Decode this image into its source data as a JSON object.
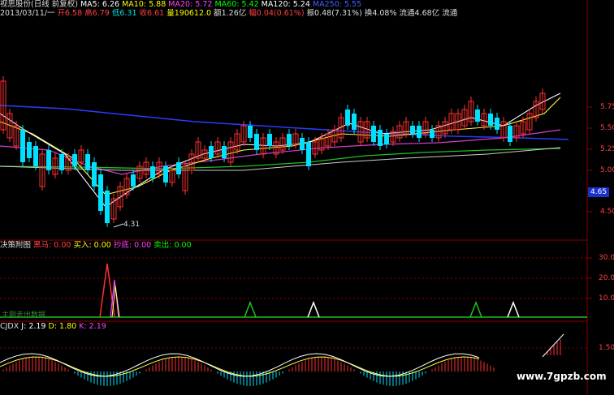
{
  "header": {
    "title": "视思股份(日线 前复权)",
    "ma": [
      {
        "label": "MA5: 6.26",
        "color": "#ffffff"
      },
      {
        "label": "MA10: 5.88",
        "color": "#ffff00"
      },
      {
        "label": "MA20: 5.72",
        "color": "#ff40ff"
      },
      {
        "label": "MA60: 5.42",
        "color": "#00ff00"
      },
      {
        "label": "MA120: 5.24",
        "color": "#ffffff"
      },
      {
        "label": "MA250: 5.55",
        "color": "#4060ff"
      }
    ],
    "info_line": [
      {
        "t": "2013/03/11/一",
        "c": "#dddddd"
      },
      {
        "t": "开6.58",
        "c": "#ff4040"
      },
      {
        "t": "高6.79",
        "c": "#ff4040"
      },
      {
        "t": "低6.31",
        "c": "#00e0e0"
      },
      {
        "t": "收6.61",
        "c": "#ff4040"
      },
      {
        "t": "量190612.0",
        "c": "#ffff00"
      },
      {
        "t": "额1.26亿",
        "c": "#dddddd"
      },
      {
        "t": "幅0.04(0.61%)",
        "c": "#ff4040"
      },
      {
        "t": "振0.48(7.31%)",
        "c": "#dddddd"
      },
      {
        "t": "换4.08%",
        "c": "#dddddd"
      },
      {
        "t": "流通4.68亿",
        "c": "#dddddd"
      },
      {
        "t": "流通",
        "c": "#dddddd"
      }
    ]
  },
  "price_axis": [
    "5.75",
    "5.50",
    "5.25",
    "5.00",
    "4.50"
  ],
  "price_marker": "4.65",
  "low_annotation": "4.31",
  "panel2": {
    "title": "决策附图",
    "items": [
      {
        "label": "黑马: 0.00",
        "color": "#ff4040"
      },
      {
        "label": "买入: 0.00",
        "color": "#ffff00"
      },
      {
        "label": "抄底: 0.00",
        "color": "#ff40ff"
      },
      {
        "label": "卖出: 0.00",
        "color": "#00ff00"
      }
    ],
    "axis": [
      "30.00",
      "20.00",
      "10.00"
    ],
    "note": "主刚走出数据"
  },
  "panel3": {
    "title": "CJDX",
    "items": [
      {
        "label": "J: 2.19",
        "color": "#ffffff"
      },
      {
        "label": "D: 1.80",
        "color": "#ffff00"
      },
      {
        "label": "K: 2.19",
        "color": "#ff40ff"
      }
    ],
    "axis": [
      "1.50"
    ]
  },
  "watermark": "www.7gpzb.com",
  "colors": {
    "up": "#ff3030",
    "down": "#00e0ff",
    "grid": "#8b0000"
  }
}
